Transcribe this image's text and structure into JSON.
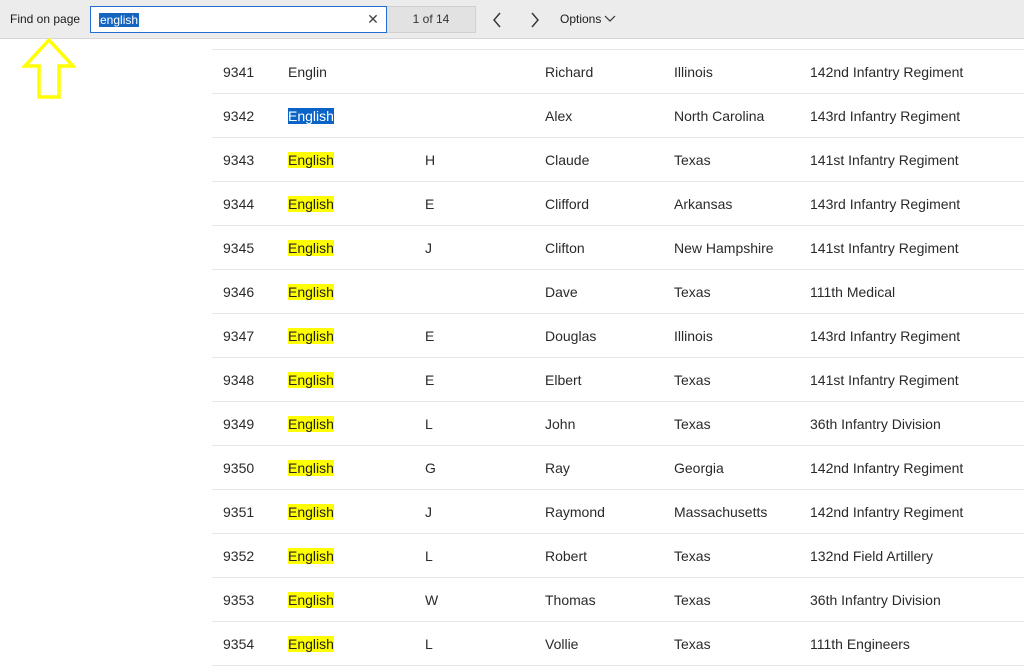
{
  "findbar": {
    "label": "Find on page",
    "query": "english",
    "match_count": "1 of 14",
    "options_label": "Options",
    "icons": {
      "clear": "close-icon",
      "prev": "chevron-left-icon",
      "next": "chevron-right-icon",
      "options": "chevron-down-icon"
    }
  },
  "annotation": {
    "icon": "up-arrow-icon",
    "color": "#ffff00"
  },
  "colors": {
    "match_highlight": "#ffff00",
    "current_match": "#0a64c8",
    "search_border": "#1e6fd0"
  },
  "rows": [
    {
      "id": "9341",
      "last": "Englin",
      "middle": "",
      "first": "Richard",
      "state": "Illinois",
      "unit": "142nd Infantry Regiment",
      "highlight": "none"
    },
    {
      "id": "9342",
      "last": "English",
      "middle": "",
      "first": "Alex",
      "state": "North Carolina",
      "unit": "143rd Infantry Regiment",
      "highlight": "current"
    },
    {
      "id": "9343",
      "last": "English",
      "middle": "H",
      "first": "Claude",
      "state": "Texas",
      "unit": "141st Infantry Regiment",
      "highlight": "match"
    },
    {
      "id": "9344",
      "last": "English",
      "middle": "E",
      "first": "Clifford",
      "state": "Arkansas",
      "unit": "143rd Infantry Regiment",
      "highlight": "match"
    },
    {
      "id": "9345",
      "last": "English",
      "middle": "J",
      "first": "Clifton",
      "state": "New Hampshire",
      "unit": "141st Infantry Regiment",
      "highlight": "match"
    },
    {
      "id": "9346",
      "last": "English",
      "middle": "",
      "first": "Dave",
      "state": "Texas",
      "unit": "111th Medical",
      "highlight": "match"
    },
    {
      "id": "9347",
      "last": "English",
      "middle": "E",
      "first": "Douglas",
      "state": "Illinois",
      "unit": "143rd Infantry Regiment",
      "highlight": "match"
    },
    {
      "id": "9348",
      "last": "English",
      "middle": "E",
      "first": "Elbert",
      "state": "Texas",
      "unit": "141st Infantry Regiment",
      "highlight": "match"
    },
    {
      "id": "9349",
      "last": "English",
      "middle": "L",
      "first": "John",
      "state": "Texas",
      "unit": "36th Infantry Division",
      "highlight": "match"
    },
    {
      "id": "9350",
      "last": "English",
      "middle": "G",
      "first": "Ray",
      "state": "Georgia",
      "unit": "142nd Infantry Regiment",
      "highlight": "match"
    },
    {
      "id": "9351",
      "last": "English",
      "middle": "J",
      "first": "Raymond",
      "state": "Massachusetts",
      "unit": "142nd Infantry Regiment",
      "highlight": "match"
    },
    {
      "id": "9352",
      "last": "English",
      "middle": "L",
      "first": "Robert",
      "state": "Texas",
      "unit": "132nd Field Artillery",
      "highlight": "match"
    },
    {
      "id": "9353",
      "last": "English",
      "middle": "W",
      "first": "Thomas",
      "state": "Texas",
      "unit": "36th Infantry Division",
      "highlight": "match"
    },
    {
      "id": "9354",
      "last": "English",
      "middle": "L",
      "first": "Vollie",
      "state": "Texas",
      "unit": "111th Engineers",
      "highlight": "match"
    }
  ]
}
